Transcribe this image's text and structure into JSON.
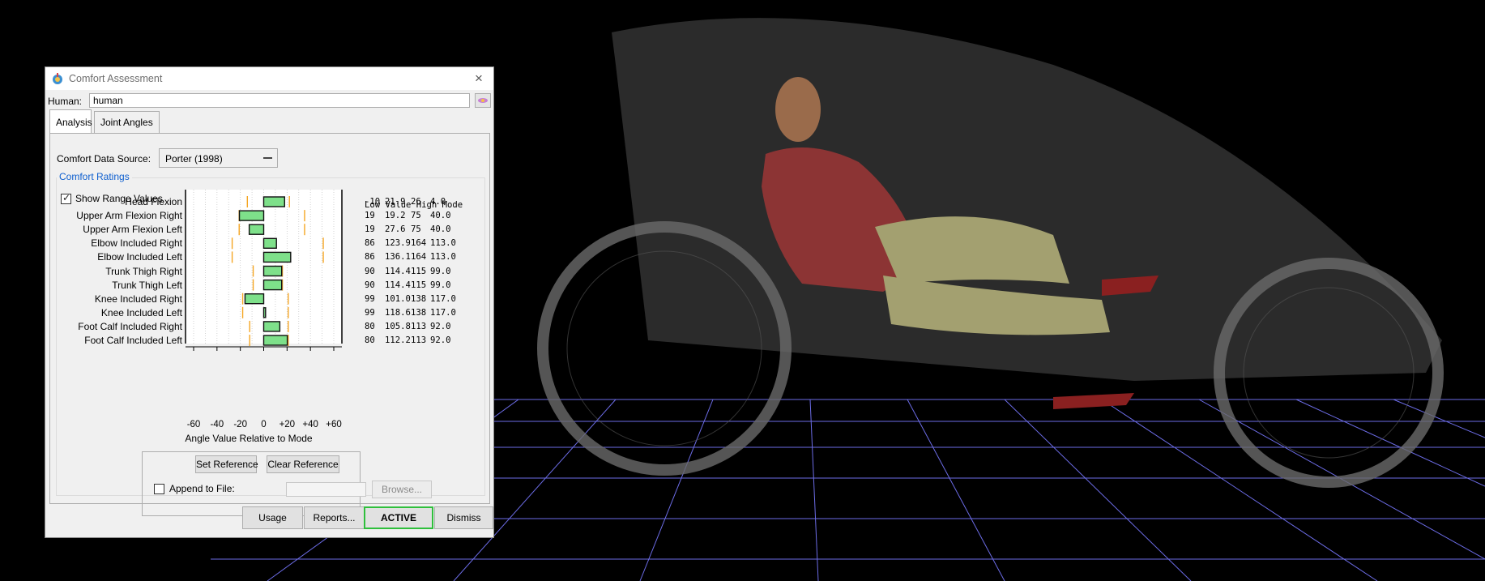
{
  "dialog": {
    "title": "Comfort Assessment",
    "close_glyph": "×",
    "human_label": "Human:",
    "human_value": "human",
    "tabs": [
      {
        "label": "Analysis",
        "active": true
      },
      {
        "label": "Joint Angles",
        "active": false
      }
    ],
    "data_source_label": "Comfort Data Source:",
    "data_source_value": "Porter (1998)",
    "group_title": "Comfort Ratings",
    "show_range_label": "Show Range Values",
    "show_range_checked": true,
    "table_header": "Low Value High Mode",
    "axis_label": "Angle Value Relative to Mode",
    "set_reference": "Set Reference",
    "clear_reference": "Clear Reference",
    "append_label": "Append to File:",
    "append_checked": false,
    "browse": "Browse...",
    "bottom_buttons": [
      "Usage",
      "Reports...",
      "ACTIVE",
      "Dismiss"
    ]
  },
  "colors": {
    "accent_blue": "#0e5fcf",
    "bar_fill": "#7ee08a",
    "bar_outline": "#111111",
    "range_tick": "#f5a623",
    "active_border": "#2fbf3c",
    "grid_line": "#7878ff",
    "background": "#000000"
  },
  "chart_data": {
    "type": "bar",
    "orientation": "horizontal",
    "xlabel": "Angle Value Relative to Mode",
    "xlim": [
      -60,
      60
    ],
    "xticks": [
      "-60",
      "-40",
      "-20",
      "0",
      "+20",
      "+40",
      "+60"
    ],
    "categories": [
      "Head Flexion",
      "Upper Arm Flexion Right",
      "Upper Arm Flexion Left",
      "Elbow Included Right",
      "Elbow Included Left",
      "Trunk Thigh Right",
      "Trunk Thigh Left",
      "Knee Included Right",
      "Knee Included Left",
      "Foot Calf Included Right",
      "Foot Calf Included Left"
    ],
    "rows": [
      {
        "low": "-10",
        "value": "21.9",
        "high": "26",
        "mode": "4.0"
      },
      {
        "low": "19",
        "value": "19.2",
        "high": "75",
        "mode": "40.0"
      },
      {
        "low": "19",
        "value": "27.6",
        "high": "75",
        "mode": "40.0"
      },
      {
        "low": "86",
        "value": "123.9",
        "high": "164",
        "mode": "113.0"
      },
      {
        "low": "86",
        "value": "136.1",
        "high": "164",
        "mode": "113.0"
      },
      {
        "low": "90",
        "value": "114.4",
        "high": "115",
        "mode": "99.0"
      },
      {
        "low": "90",
        "value": "114.4",
        "high": "115",
        "mode": "99.0"
      },
      {
        "low": "99",
        "value": "101.0",
        "high": "138",
        "mode": "117.0"
      },
      {
        "low": "99",
        "value": "118.6",
        "high": "138",
        "mode": "117.0"
      },
      {
        "low": "80",
        "value": "105.8",
        "high": "113",
        "mode": "92.0"
      },
      {
        "low": "80",
        "value": "112.2",
        "high": "113",
        "mode": "92.0"
      }
    ],
    "series": [
      {
        "values": [
          17.9,
          -20.8,
          -12.4,
          10.9,
          23.1,
          15.4,
          15.4,
          -16.0,
          1.6,
          13.8,
          20.2
        ]
      },
      {
        "name": "range",
        "values": [
          [
            -14,
            22
          ],
          [
            -21,
            35
          ],
          [
            -21,
            35
          ],
          [
            -27,
            51
          ],
          [
            -27,
            51
          ],
          [
            -9,
            16
          ],
          [
            -9,
            16
          ],
          [
            -18,
            21
          ],
          [
            -18,
            21
          ],
          [
            -12,
            21
          ],
          [
            -12,
            21
          ]
        ]
      }
    ]
  }
}
